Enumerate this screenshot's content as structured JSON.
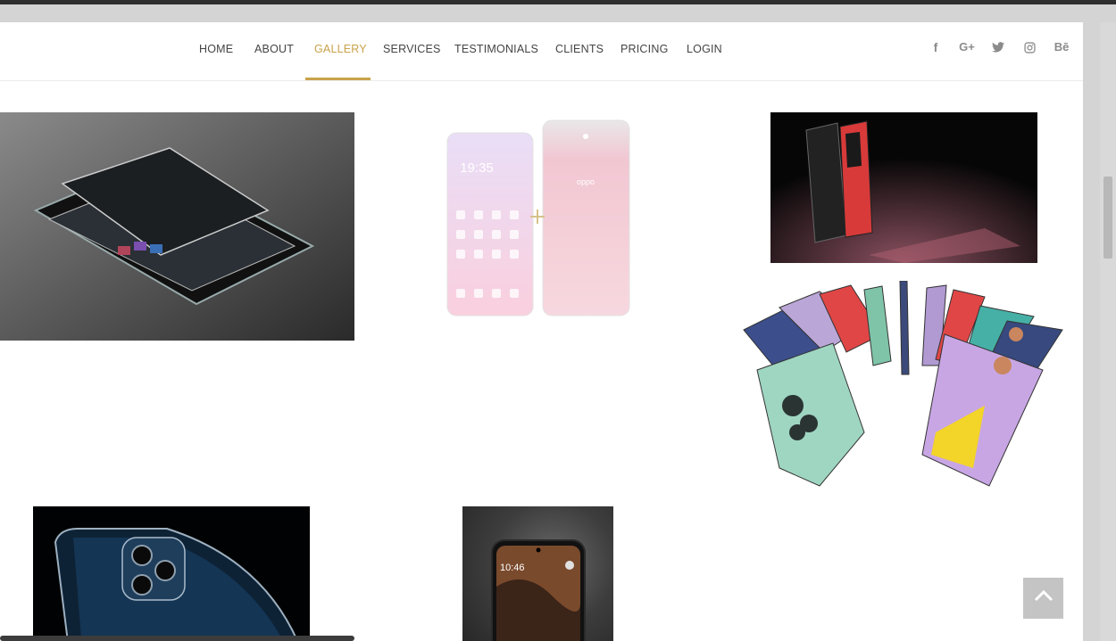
{
  "navbar": {
    "items": [
      {
        "label": "HOME"
      },
      {
        "label": "ABOUT"
      },
      {
        "label": "GALLERY",
        "active": true
      },
      {
        "label": "SERVICES"
      },
      {
        "label": "TESTIMONIALS"
      },
      {
        "label": "CLIENTS"
      },
      {
        "label": "PRICING"
      },
      {
        "label": "LOGIN"
      }
    ],
    "social": [
      {
        "name": "facebook-icon",
        "text": "f"
      },
      {
        "name": "google-plus-icon",
        "text": "G+"
      },
      {
        "name": "twitter-icon"
      },
      {
        "name": "instagram-icon"
      },
      {
        "name": "behance-icon",
        "text": "Bē"
      }
    ]
  },
  "gallery": {
    "images": [
      {
        "name": "tablets-image"
      },
      {
        "name": "oppo-phones-image",
        "brand_text": "oppo",
        "clock_text": "19:35"
      },
      {
        "name": "red-phones-image"
      },
      {
        "name": "fan-phones-image"
      },
      {
        "name": "iphone-image"
      },
      {
        "name": "dark-phone-image",
        "clock_text": "10:46"
      }
    ]
  },
  "colors": {
    "accent": "#c9a24a",
    "nav_text": "#444444",
    "social_icon": "#8b8b8b",
    "back_to_top": "#c4c4c4"
  }
}
